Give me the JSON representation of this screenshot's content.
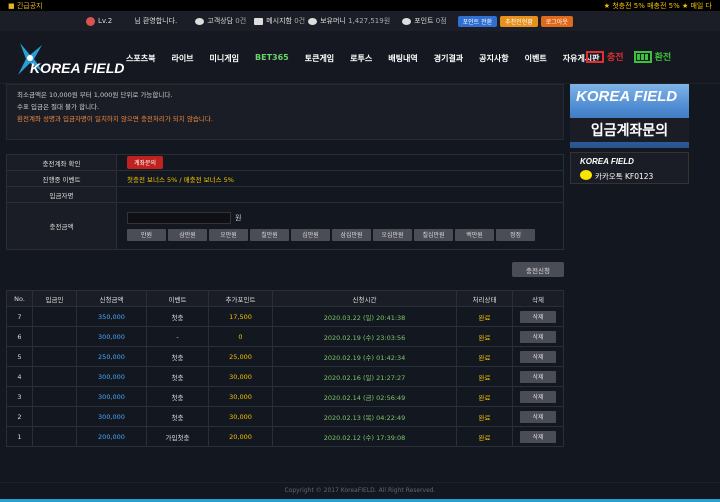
{
  "topbar": {
    "notice": "■ 긴급공지",
    "ticker": "★ 첫충전 5% 매충전 5% ★ 매일 다"
  },
  "userbar": {
    "level": "Lv.2",
    "welcome": "님 환영합니다.",
    "consult_label": "고객상담",
    "consult_count": "0건",
    "message_label": "메시지함",
    "message_count": "0건",
    "money_label": "보유머니",
    "money_value": "1,427,519원",
    "point_label": "포인트",
    "point_value": "0점",
    "btn_point": "포인트 전환",
    "btn_recommend": "추천인현황",
    "btn_logout": "로그아웃"
  },
  "nav": {
    "logo": "KOREA FIELD",
    "menu": [
      "스포츠북",
      "라이브",
      "미니게임",
      "BET365",
      "토큰게임",
      "로투스",
      "배팅내역",
      "경기결과",
      "공지사항",
      "이벤트",
      "자유게시판"
    ],
    "charge": "충전",
    "exchange": "환전"
  },
  "info": {
    "line1": "최소금액은 10,000원 부터 1,000원 단위로 가능합니다.",
    "line2": "수표 입금은 절대 불가 합니다.",
    "line3": "환전계좌 성명과 입금자명이 일치하지 않으면 충전처리가 되지 않습니다."
  },
  "form": {
    "account_label": "충전계좌 확인",
    "account_btn": "계좌문의",
    "event_label": "진행중 이벤트",
    "event_value": "첫충전 보너스 5% / 매충전 보너스 5%",
    "depositor_label": "입금자명",
    "amount_label": "충전금액",
    "amount_unit": "원",
    "quick": [
      "만원",
      "삼만원",
      "오만원",
      "칠만원",
      "십만원",
      "삼십만원",
      "오십만원",
      "칠십만원",
      "백만원",
      "정정"
    ]
  },
  "apply_btn": "충전신청",
  "table": {
    "headers": [
      "No.",
      "입금인",
      "신청금액",
      "이벤트",
      "추가포인트",
      "신청시간",
      "처리상태",
      "삭제"
    ],
    "rows": [
      {
        "no": "7",
        "name": "",
        "amount": "350,000",
        "event": "첫충",
        "bonus": "17,500",
        "time": "2020.03.22 (일) 20:41:38",
        "status": "완료",
        "del": "삭제"
      },
      {
        "no": "6",
        "name": "",
        "amount": "300,000",
        "event": "-",
        "bonus": "0",
        "time": "2020.02.19 (수) 23:03:56",
        "status": "완료",
        "del": "삭제"
      },
      {
        "no": "5",
        "name": "",
        "amount": "250,000",
        "event": "첫충",
        "bonus": "25,000",
        "time": "2020.02.19 (수) 01:42:34",
        "status": "완료",
        "del": "삭제"
      },
      {
        "no": "4",
        "name": "",
        "amount": "300,000",
        "event": "첫충",
        "bonus": "30,000",
        "time": "2020.02.16 (일) 21:27:27",
        "status": "완료",
        "del": "삭제"
      },
      {
        "no": "3",
        "name": "",
        "amount": "300,000",
        "event": "첫충",
        "bonus": "30,000",
        "time": "2020.02.14 (금) 02:56:49",
        "status": "완료",
        "del": "삭제"
      },
      {
        "no": "2",
        "name": "",
        "amount": "300,000",
        "event": "첫충",
        "bonus": "30,000",
        "time": "2020.02.13 (목) 04:22:49",
        "status": "완료",
        "del": "삭제"
      },
      {
        "no": "1",
        "name": "",
        "amount": "200,000",
        "event": "가입첫충",
        "bonus": "20,000",
        "time": "2020.02.12 (수) 17:39:08",
        "status": "완료",
        "del": "삭제"
      }
    ]
  },
  "banner1": {
    "title": "KOREA FIELD",
    "subtitle": "입금계좌문의"
  },
  "banner2": {
    "title": "KOREA FIELD",
    "kakao": "카카오톡  KF0123"
  },
  "footer": "Copyright © 2017 KoreaFIELD. All Right Reserved."
}
